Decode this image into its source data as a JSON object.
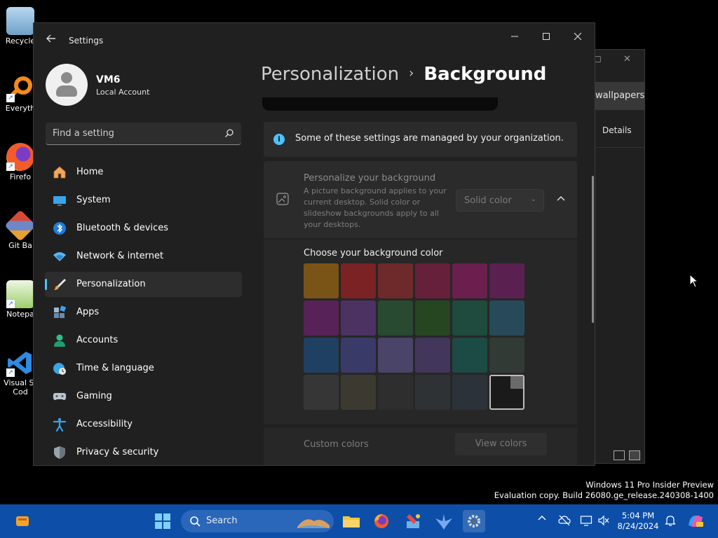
{
  "desktop": {
    "icons": [
      {
        "label": "Recycle"
      },
      {
        "label": "Everyth"
      },
      {
        "label": "Firefo"
      },
      {
        "label": "Git Ba"
      },
      {
        "label": "Notepa"
      },
      {
        "label": "Visual St Cod"
      }
    ],
    "background_window": {
      "wallpapers_label": "wallpapers",
      "details_label": "Details"
    },
    "watermark": {
      "line1": "Windows 11 Pro Insider Preview",
      "line2": "Evaluation copy. Build 26080.ge_release.240308-1400"
    }
  },
  "window": {
    "title": "Settings",
    "minimize_icon": "minimize-icon",
    "maximize_icon": "maximize-icon",
    "close_icon": "close-icon"
  },
  "sidebar": {
    "user_name": "VM6",
    "account_type": "Local Account",
    "search_placeholder": "Find a setting",
    "items": [
      {
        "label": "Home",
        "icon": "home-icon"
      },
      {
        "label": "System",
        "icon": "system-icon"
      },
      {
        "label": "Bluetooth & devices",
        "icon": "bluetooth-icon"
      },
      {
        "label": "Network & internet",
        "icon": "network-icon"
      },
      {
        "label": "Personalization",
        "icon": "brush-icon",
        "active": true
      },
      {
        "label": "Apps",
        "icon": "apps-icon"
      },
      {
        "label": "Accounts",
        "icon": "accounts-icon"
      },
      {
        "label": "Time & language",
        "icon": "globe-clock-icon"
      },
      {
        "label": "Gaming",
        "icon": "gamepad-icon"
      },
      {
        "label": "Accessibility",
        "icon": "accessibility-icon"
      },
      {
        "label": "Privacy & security",
        "icon": "shield-icon"
      }
    ]
  },
  "content": {
    "breadcrumb_parent": "Personalization",
    "breadcrumb_separator": "›",
    "breadcrumb_current": "Background",
    "info_message": "Some of these settings are managed by your organization.",
    "personalize": {
      "title": "Personalize your background",
      "description": "A picture background applies to your current desktop. Solid color or slideshow backgrounds apply to all your desktops.",
      "selected_option": "Solid color"
    },
    "color_section_title": "Choose your background color",
    "swatch_colors": [
      "#7a5416",
      "#7a2224",
      "#6e2a2a",
      "#66203a",
      "#6a1f4e",
      "#5a2050",
      "#562258",
      "#4c3262",
      "#284a30",
      "#254620",
      "#1f4a3e",
      "#284a58",
      "#1f4060",
      "#3a3a68",
      "#4a4468",
      "#42365a",
      "#1c4a44",
      "#323a36",
      "#363636",
      "#3c3a30",
      "#2e2e2e",
      "#2e3234",
      "#2c323a",
      "#1a1a1a"
    ],
    "selected_swatch_index": 23,
    "custom_colors_label": "Custom colors",
    "view_colors_label": "View colors"
  },
  "taskbar": {
    "search_label": "Search",
    "time": "5:04 PM",
    "date": "8/24/2024"
  }
}
